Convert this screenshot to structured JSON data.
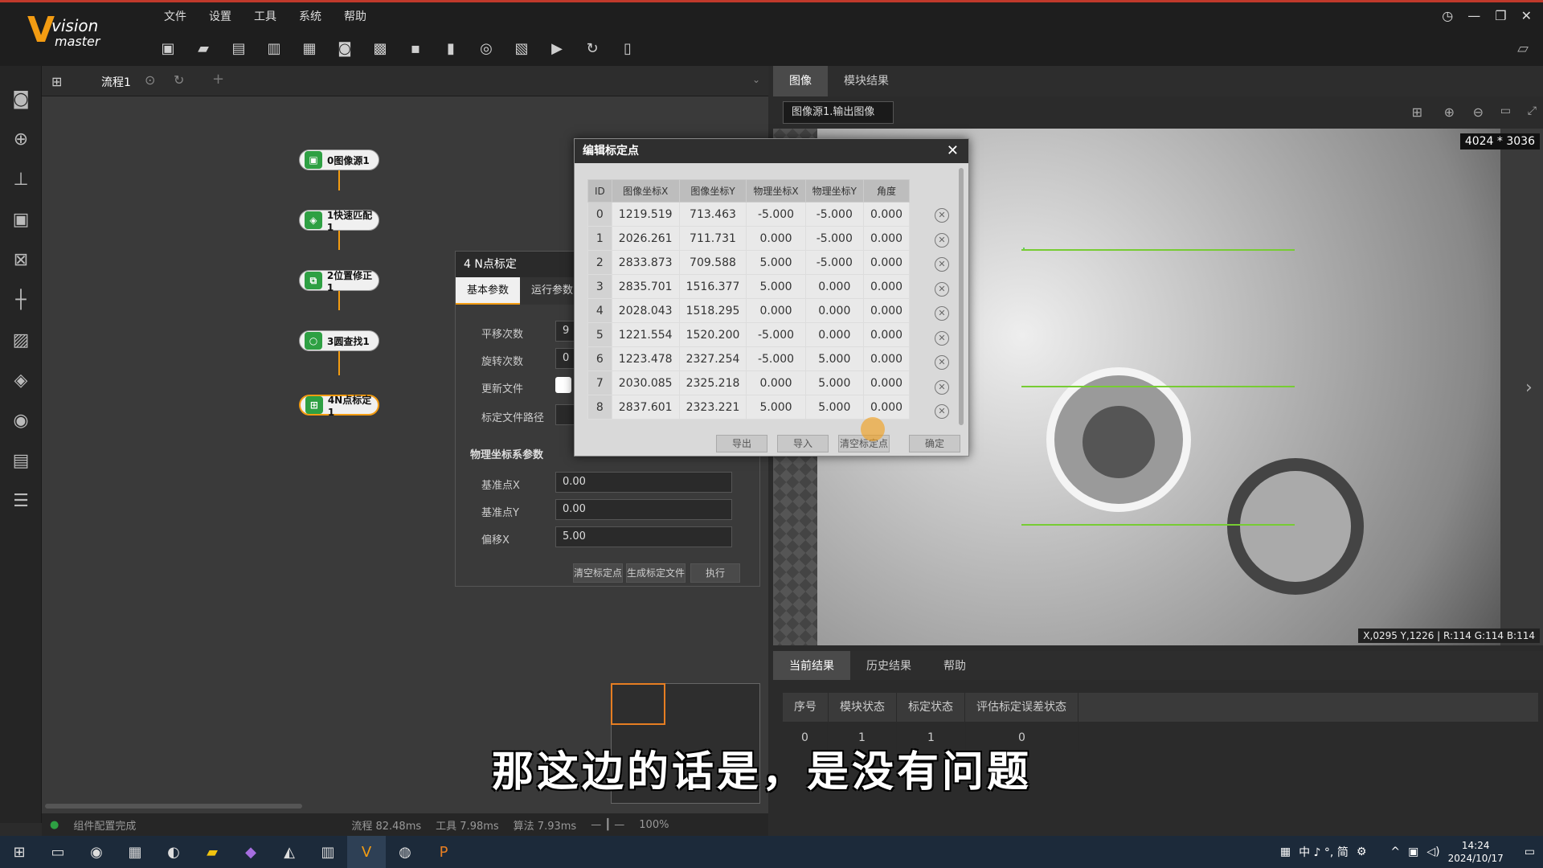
{
  "app": {
    "logo_main": "vision",
    "logo_sub": "master"
  },
  "menu": [
    "文件",
    "设置",
    "工具",
    "系统",
    "帮助"
  ],
  "flow": {
    "tab_label": "流程1",
    "nodes": [
      {
        "label": "0图像源1"
      },
      {
        "label": "1快速匹配1"
      },
      {
        "label": "2位置修正1"
      },
      {
        "label": "3圆查找1"
      },
      {
        "label": "4N点标定1"
      }
    ]
  },
  "status": {
    "message": "组件配置完成",
    "flow_time": "流程 82.48ms",
    "tool_time": "工具 7.98ms",
    "algo_time": "算法 7.93ms",
    "zoom": "100%"
  },
  "image_panel": {
    "tabs": [
      "图像",
      "模块结果"
    ],
    "source_select": "图像源1.输出图像",
    "size_label": "4024 * 3036",
    "pixel_info": "X,0295 Y,1226 | R:114 G:114 B:114"
  },
  "result_panel": {
    "tabs": [
      "当前结果",
      "历史结果",
      "帮助"
    ],
    "columns": [
      "序号",
      "模块状态",
      "标定状态",
      "评估标定误差状态"
    ],
    "rows": [
      [
        "0",
        "1",
        "1",
        "0"
      ]
    ]
  },
  "npt_dialog": {
    "title": "4 N点标定",
    "tabs": [
      "基本参数",
      "运行参数"
    ],
    "fields": [
      {
        "label": "平移次数",
        "value": "9"
      },
      {
        "label": "旋转次数",
        "value": "0"
      },
      {
        "label": "更新文件",
        "value": ""
      },
      {
        "label": "标定文件路径",
        "value": ""
      }
    ],
    "section": "物理坐标系参数",
    "phys_fields": [
      {
        "label": "基准点X",
        "value": "0.00"
      },
      {
        "label": "基准点Y",
        "value": "0.00"
      },
      {
        "label": "偏移X",
        "value": "5.00"
      }
    ],
    "buttons": [
      "清空标定点",
      "生成标定文件",
      "执行"
    ]
  },
  "edit_dialog": {
    "title": "编辑标定点",
    "columns": [
      "ID",
      "图像坐标X",
      "图像坐标Y",
      "物理坐标X",
      "物理坐标Y",
      "角度"
    ],
    "rows": [
      [
        "0",
        "1219.519",
        "713.463",
        "-5.000",
        "-5.000",
        "0.000"
      ],
      [
        "1",
        "2026.261",
        "711.731",
        "0.000",
        "-5.000",
        "0.000"
      ],
      [
        "2",
        "2833.873",
        "709.588",
        "5.000",
        "-5.000",
        "0.000"
      ],
      [
        "3",
        "2835.701",
        "1516.377",
        "5.000",
        "0.000",
        "0.000"
      ],
      [
        "4",
        "2028.043",
        "1518.295",
        "0.000",
        "0.000",
        "0.000"
      ],
      [
        "5",
        "1221.554",
        "1520.200",
        "-5.000",
        "0.000",
        "0.000"
      ],
      [
        "6",
        "1223.478",
        "2327.254",
        "-5.000",
        "5.000",
        "0.000"
      ],
      [
        "7",
        "2030.085",
        "2325.218",
        "0.000",
        "5.000",
        "0.000"
      ],
      [
        "8",
        "2837.601",
        "2323.221",
        "5.000",
        "5.000",
        "0.000"
      ]
    ],
    "buttons": [
      "导出",
      "导入",
      "清空标定点",
      "确定"
    ]
  },
  "subtitle": "那这边的话是，是没有问题",
  "clock": {
    "time": "14:24",
    "date": "2024/10/17"
  },
  "tray_text": "中 ♪ °, 简"
}
